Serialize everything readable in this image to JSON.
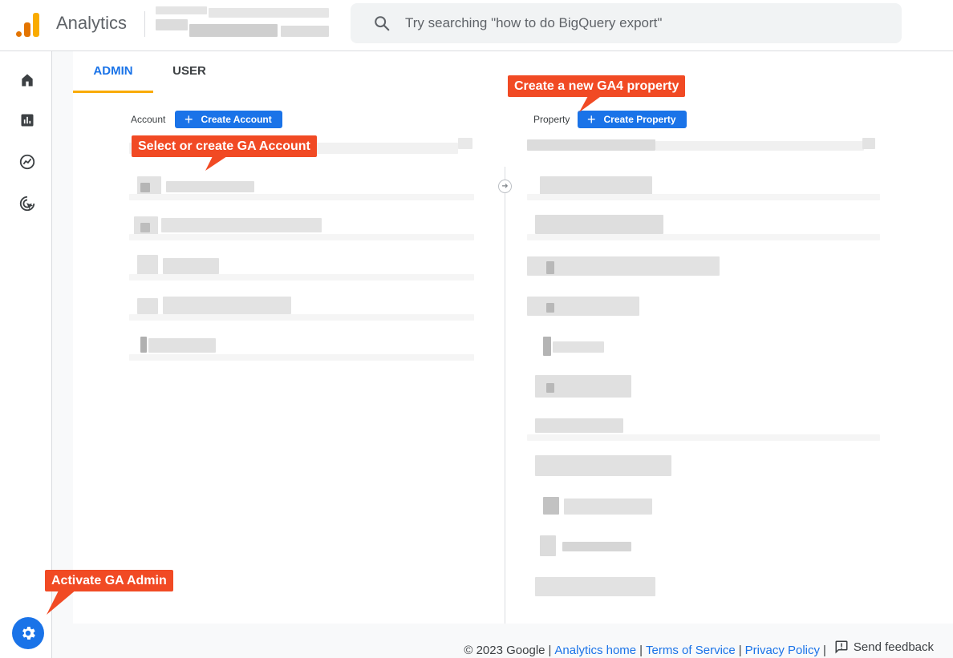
{
  "header": {
    "app_title": "Analytics",
    "search_placeholder": "Try searching \"how to do BigQuery export\""
  },
  "tabs": [
    {
      "label": "ADMIN",
      "active": true
    },
    {
      "label": "USER",
      "active": false
    }
  ],
  "account_column": {
    "label": "Account",
    "create_button": "Create Account"
  },
  "property_column": {
    "label": "Property",
    "create_button": "Create Property"
  },
  "callouts": {
    "create_property": "Create a new GA4 property",
    "select_account": "Select or create GA Account",
    "activate_admin": "Activate GA Admin"
  },
  "nav_icons": [
    "home-icon",
    "reports-icon",
    "explore-icon",
    "advertising-icon"
  ],
  "footer": {
    "copyright": "© 2023 Google",
    "analytics_home": "Analytics home",
    "terms": "Terms of Service",
    "privacy": "Privacy Policy",
    "feedback": "Send feedback"
  },
  "colors": {
    "accent": "#1a73e8",
    "callout": "#f14a24",
    "tab_underline": "#f9ab00"
  }
}
